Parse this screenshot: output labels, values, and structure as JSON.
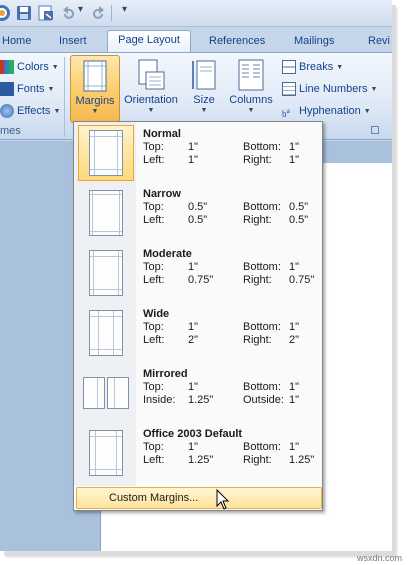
{
  "qat": {
    "icons": [
      "word-app-icon",
      "save-icon",
      "save-as-pdf-icon",
      "undo-icon",
      "redo-icon",
      "customize-qat-icon"
    ]
  },
  "tabs": [
    {
      "label": "Home",
      "active": false
    },
    {
      "label": "Insert",
      "active": false
    },
    {
      "label": "Page Layout",
      "active": true
    },
    {
      "label": "References",
      "active": false
    },
    {
      "label": "Mailings",
      "active": false
    },
    {
      "label": "Revi",
      "active": false
    }
  ],
  "ribbon": {
    "themes": {
      "colors_label": "Colors",
      "fonts_label": "Fonts",
      "effects_label": "Effects",
      "group_label": "mes"
    },
    "page_setup": {
      "margins_label": "Margins",
      "orientation_label": "Orientation",
      "size_label": "Size",
      "columns_label": "Columns",
      "breaks_label": "Breaks",
      "line_numbers_label": "Line Numbers",
      "hyphenation_label": "Hyphenation"
    }
  },
  "margins_menu": {
    "presets": [
      {
        "name": "Normal",
        "k1": "Top:",
        "v1": "1\"",
        "k2": "Bottom:",
        "v2": "1\"",
        "k3": "Left:",
        "v3": "1\"",
        "k4": "Right:",
        "v4": "1\"",
        "selected": true
      },
      {
        "name": "Narrow",
        "k1": "Top:",
        "v1": "0.5\"",
        "k2": "Bottom:",
        "v2": "0.5\"",
        "k3": "Left:",
        "v3": "0.5\"",
        "k4": "Right:",
        "v4": "0.5\"",
        "selected": false
      },
      {
        "name": "Moderate",
        "k1": "Top:",
        "v1": "1\"",
        "k2": "Bottom:",
        "v2": "1\"",
        "k3": "Left:",
        "v3": "0.75\"",
        "k4": "Right:",
        "v4": "0.75\"",
        "selected": false
      },
      {
        "name": "Wide",
        "k1": "Top:",
        "v1": "1\"",
        "k2": "Bottom:",
        "v2": "1\"",
        "k3": "Left:",
        "v3": "2\"",
        "k4": "Right:",
        "v4": "2\"",
        "selected": false
      },
      {
        "name": "Mirrored",
        "k1": "Top:",
        "v1": "1\"",
        "k2": "Bottom:",
        "v2": "1\"",
        "k3": "Inside:",
        "v3": "1.25\"",
        "k4": "Outside:",
        "v4": "1\"",
        "selected": false
      },
      {
        "name": "Office 2003 Default",
        "k1": "Top:",
        "v1": "1\"",
        "k2": "Bottom:",
        "v2": "1\"",
        "k3": "Left:",
        "v3": "1.25\"",
        "k4": "Right:",
        "v4": "1.25\"",
        "selected": false
      }
    ],
    "custom_label": "Custom Margins..."
  },
  "watermark": "wsxdn.com",
  "colors": {
    "accent": "#15428b",
    "ribbon_bg": "#dfe9f6",
    "highlight": "#ffd97a"
  }
}
